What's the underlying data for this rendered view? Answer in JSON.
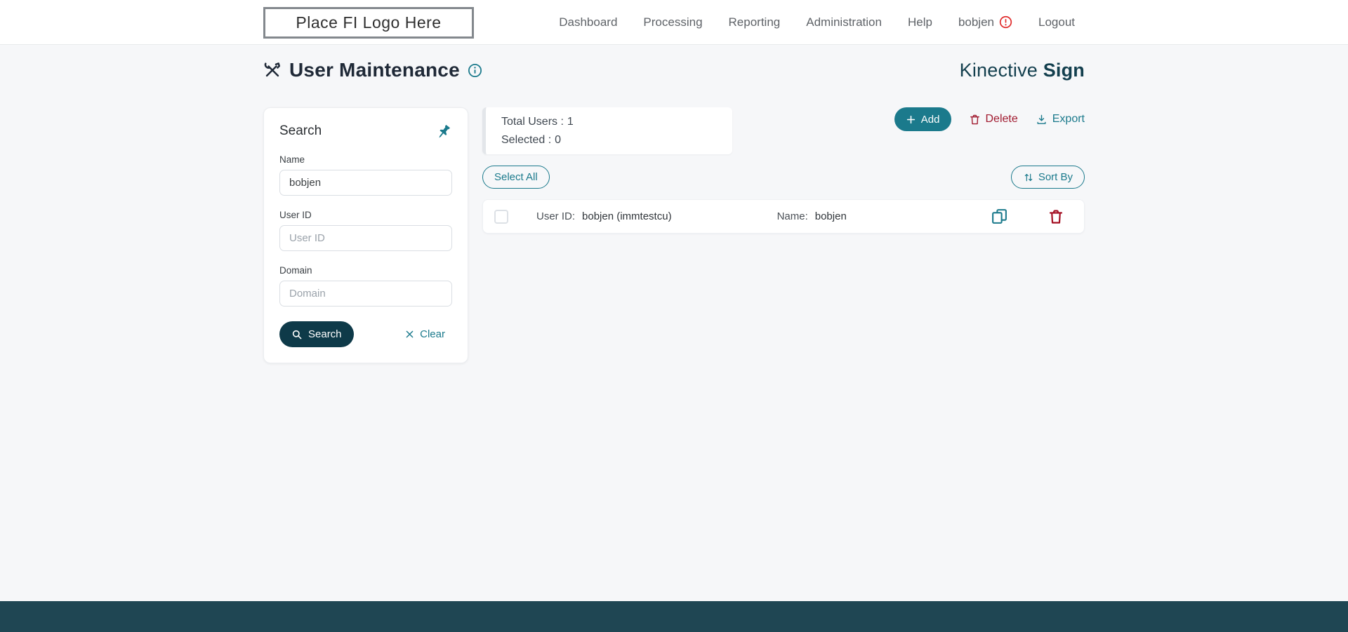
{
  "header": {
    "logo_text": "Place FI Logo Here",
    "nav": [
      {
        "label": "Dashboard"
      },
      {
        "label": "Processing"
      },
      {
        "label": "Reporting"
      },
      {
        "label": "Administration"
      },
      {
        "label": "Help"
      },
      {
        "label": "bobjen",
        "has_alert": true
      },
      {
        "label": "Logout"
      }
    ]
  },
  "page": {
    "title": "User Maintenance",
    "brand_name": "Kinective",
    "brand_product": "Sign"
  },
  "search_panel": {
    "title": "Search",
    "name_label": "Name",
    "name_value": "bobjen",
    "user_id_label": "User ID",
    "user_id_placeholder": "User ID",
    "domain_label": "Domain",
    "domain_placeholder": "Domain",
    "search_button": "Search",
    "clear_button": "Clear"
  },
  "toolbar": {
    "add_label": "Add",
    "delete_label": "Delete",
    "export_label": "Export",
    "select_all_label": "Select All",
    "sort_by_label": "Sort By"
  },
  "summary": {
    "rows": [
      {
        "label": "Total Users :",
        "value": "1"
      },
      {
        "label": "Selected :",
        "value": "0"
      }
    ]
  },
  "users": [
    {
      "user_id_label": "User ID:",
      "user_id": "bobjen (immtestcu)",
      "name_label": "Name:",
      "name": "bobjen",
      "selected": false
    }
  ],
  "icons": {
    "title_icon": "tools-icon",
    "title_info": "info-icon",
    "search_pin": "pushpin-icon",
    "nav_alert": "alert-circle-icon",
    "row_copy": "copy-icon",
    "row_delete": "trash-icon"
  },
  "colors": {
    "accent_teal": "#1B7A8C",
    "dark_button_teal": "#0E3A49",
    "brand_navy": "#133F4E",
    "danger_red": "#A11B30",
    "footer_bar": "#1F4653",
    "page_background": "#F6F7F9"
  }
}
